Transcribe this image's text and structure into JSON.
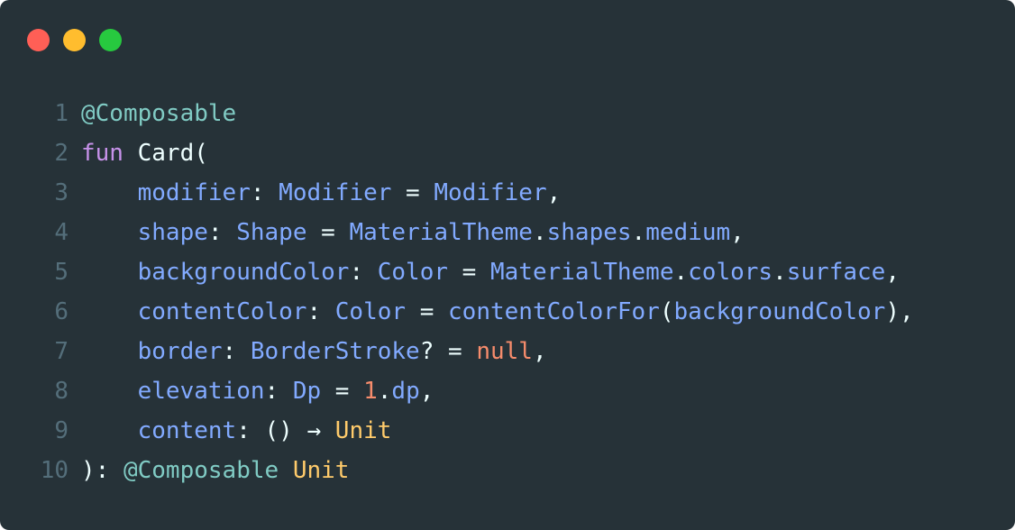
{
  "window": {
    "traffic_lights": [
      {
        "name": "close",
        "color": "#ff5f56"
      },
      {
        "name": "minimize",
        "color": "#ffbd2e"
      },
      {
        "name": "maximize",
        "color": "#27c93f"
      }
    ],
    "background": "#263238"
  },
  "code": {
    "language": "kotlin",
    "lines": [
      {
        "number": "1",
        "tokens": [
          {
            "t": "annotation",
            "v": "@Composable"
          }
        ]
      },
      {
        "number": "2",
        "tokens": [
          {
            "t": "keyword",
            "v": "fun"
          },
          {
            "t": "punct",
            "v": " "
          },
          {
            "t": "name",
            "v": "Card"
          },
          {
            "t": "punct",
            "v": "("
          }
        ]
      },
      {
        "number": "3",
        "tokens": [
          {
            "t": "punct",
            "v": "    "
          },
          {
            "t": "param",
            "v": "modifier"
          },
          {
            "t": "punct",
            "v": ": "
          },
          {
            "t": "type",
            "v": "Modifier"
          },
          {
            "t": "punct",
            "v": " = "
          },
          {
            "t": "type",
            "v": "Modifier"
          },
          {
            "t": "punct",
            "v": ","
          }
        ]
      },
      {
        "number": "4",
        "tokens": [
          {
            "t": "punct",
            "v": "    "
          },
          {
            "t": "param",
            "v": "shape"
          },
          {
            "t": "punct",
            "v": ": "
          },
          {
            "t": "type",
            "v": "Shape"
          },
          {
            "t": "punct",
            "v": " = "
          },
          {
            "t": "type",
            "v": "MaterialTheme"
          },
          {
            "t": "punct",
            "v": "."
          },
          {
            "t": "type",
            "v": "shapes"
          },
          {
            "t": "punct",
            "v": "."
          },
          {
            "t": "type",
            "v": "medium"
          },
          {
            "t": "punct",
            "v": ","
          }
        ]
      },
      {
        "number": "5",
        "tokens": [
          {
            "t": "punct",
            "v": "    "
          },
          {
            "t": "param",
            "v": "backgroundColor"
          },
          {
            "t": "punct",
            "v": ": "
          },
          {
            "t": "type",
            "v": "Color"
          },
          {
            "t": "punct",
            "v": " = "
          },
          {
            "t": "type",
            "v": "MaterialTheme"
          },
          {
            "t": "punct",
            "v": "."
          },
          {
            "t": "type",
            "v": "colors"
          },
          {
            "t": "punct",
            "v": "."
          },
          {
            "t": "type",
            "v": "surface"
          },
          {
            "t": "punct",
            "v": ","
          }
        ]
      },
      {
        "number": "6",
        "tokens": [
          {
            "t": "punct",
            "v": "    "
          },
          {
            "t": "param",
            "v": "contentColor"
          },
          {
            "t": "punct",
            "v": ": "
          },
          {
            "t": "type",
            "v": "Color"
          },
          {
            "t": "punct",
            "v": " = "
          },
          {
            "t": "type",
            "v": "contentColorFor"
          },
          {
            "t": "punct",
            "v": "("
          },
          {
            "t": "type",
            "v": "backgroundColor"
          },
          {
            "t": "punct",
            "v": "),"
          }
        ]
      },
      {
        "number": "7",
        "tokens": [
          {
            "t": "punct",
            "v": "    "
          },
          {
            "t": "param",
            "v": "border"
          },
          {
            "t": "punct",
            "v": ": "
          },
          {
            "t": "type",
            "v": "BorderStroke"
          },
          {
            "t": "punct",
            "v": "? = "
          },
          {
            "t": "null",
            "v": "null"
          },
          {
            "t": "punct",
            "v": ","
          }
        ]
      },
      {
        "number": "8",
        "tokens": [
          {
            "t": "punct",
            "v": "    "
          },
          {
            "t": "param",
            "v": "elevation"
          },
          {
            "t": "punct",
            "v": ": "
          },
          {
            "t": "type",
            "v": "Dp"
          },
          {
            "t": "punct",
            "v": " = "
          },
          {
            "t": "number",
            "v": "1"
          },
          {
            "t": "punct",
            "v": "."
          },
          {
            "t": "type",
            "v": "dp"
          },
          {
            "t": "punct",
            "v": ","
          }
        ]
      },
      {
        "number": "9",
        "tokens": [
          {
            "t": "punct",
            "v": "    "
          },
          {
            "t": "param",
            "v": "content"
          },
          {
            "t": "punct",
            "v": ": () "
          },
          {
            "t": "arrow",
            "v": "→"
          },
          {
            "t": "punct",
            "v": " "
          },
          {
            "t": "unit",
            "v": "Unit"
          }
        ]
      },
      {
        "number": "10",
        "tokens": [
          {
            "t": "punct",
            "v": "): "
          },
          {
            "t": "annotation",
            "v": "@Composable"
          },
          {
            "t": "punct",
            "v": " "
          },
          {
            "t": "unit",
            "v": "Unit"
          }
        ]
      }
    ]
  }
}
